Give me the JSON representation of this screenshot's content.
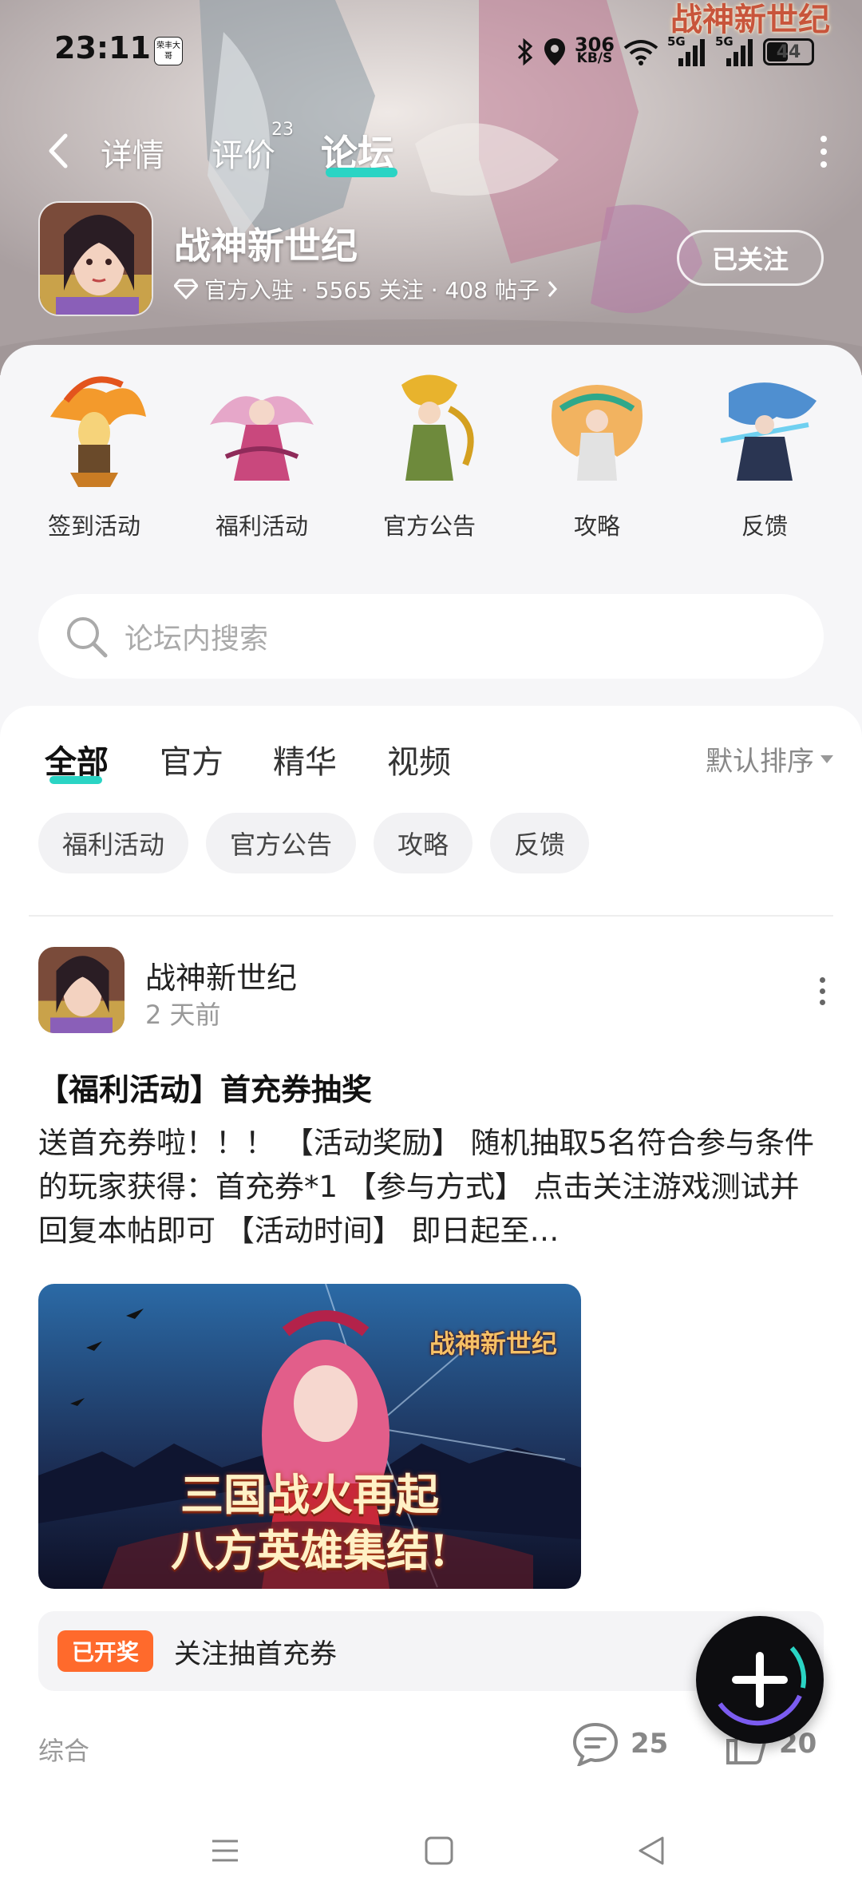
{
  "status_bar": {
    "time": "23:11",
    "app_badge": "荣丰大哥",
    "net_speed_value": "306",
    "net_speed_unit": "KB/S",
    "signal_1": "5G",
    "signal_2": "5G",
    "battery": "44"
  },
  "nav": {
    "tabs": [
      {
        "label": "详情"
      },
      {
        "label": "评价",
        "count": "23"
      },
      {
        "label": "论坛"
      }
    ],
    "active_tab": "论坛"
  },
  "game": {
    "title": "战神新世纪",
    "meta": "官方入驻 · 5565 关注 · 408 帖子",
    "follow_label": "已关注",
    "header_logo": "战神新世纪"
  },
  "categories": [
    {
      "label": "签到活动"
    },
    {
      "label": "福利活动"
    },
    {
      "label": "官方公告"
    },
    {
      "label": "攻略"
    },
    {
      "label": "反馈"
    }
  ],
  "search": {
    "placeholder": "论坛内搜索"
  },
  "filter_tabs": [
    {
      "label": "全部"
    },
    {
      "label": "官方"
    },
    {
      "label": "精华"
    },
    {
      "label": "视频"
    }
  ],
  "sort_label": "默认排序",
  "chips": [
    "福利活动",
    "官方公告",
    "攻略",
    "反馈"
  ],
  "post": {
    "author": "战神新世纪",
    "time": "2 天前",
    "title": "【福利活动】首充券抽奖",
    "body": "送首充券啦！！！ 【活动奖励】 随机抽取5名符合参与条件的玩家获得：首充券*1 【参与方式】 点击关注游戏测试并回复本帖即可 【活动时间】 即日起至…",
    "image_line1": "三国战火再起",
    "image_line2": "八方英雄集结!",
    "image_logo": "战神新世纪",
    "lottery_badge": "已开奖",
    "lottery_text": "关注抽首充券",
    "tag": "综合",
    "comments": "25",
    "likes": "20"
  },
  "colors": {
    "accent": "#2ad4c4",
    "lottery_badge": "#ff6a2c",
    "fab": "#0d0d10"
  },
  "icons": {
    "back": "chevron-left-icon",
    "more": "more-vertical-icon",
    "verified": "diamond-icon",
    "search": "search-icon",
    "comment": "comment-icon",
    "like": "thumbs-up-icon",
    "fab": "plus-icon"
  }
}
